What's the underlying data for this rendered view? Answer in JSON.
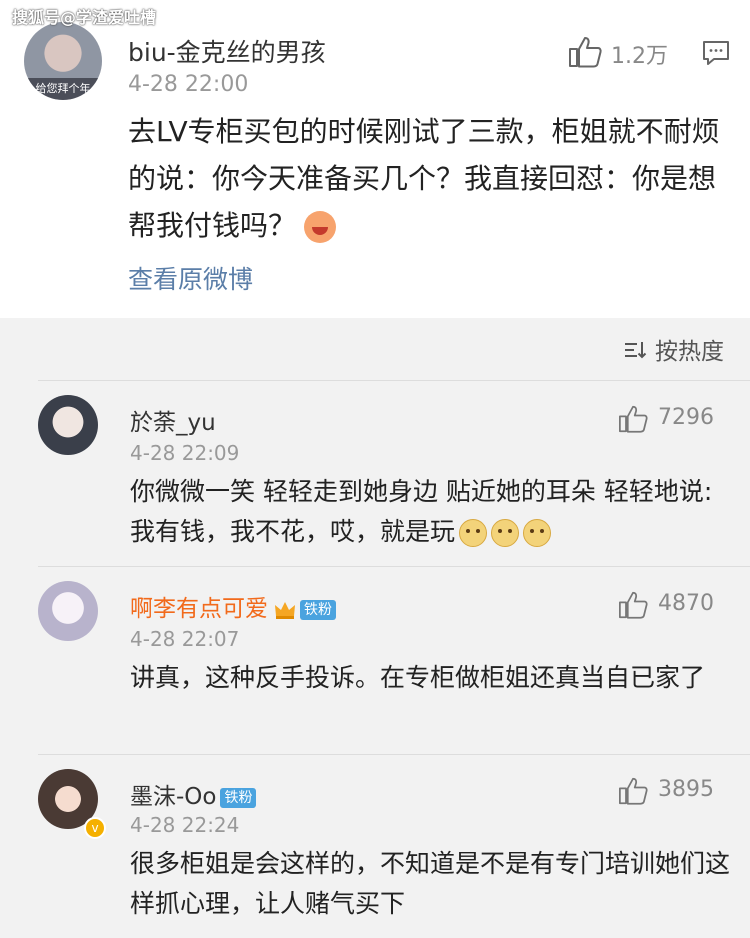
{
  "watermark": "搜狐号@学渣爱吐槽",
  "main_post": {
    "avatar_caption": "给您拜个年",
    "username": "biu-金克丝的男孩",
    "time": "4-28 22:00",
    "like_count": "1.2万",
    "text": "去LV专柜买包的时候刚试了三款，柜姐就不耐烦的说：你今天准备买几个？我直接回怼：你是想帮我付钱吗？",
    "view_original": "查看原微博"
  },
  "sort_label": "按热度",
  "comments": [
    {
      "username": "於荼_yu",
      "time": "4-28 22:09",
      "likes": "7296",
      "text": "你微微一笑 轻轻走到她身边 贴近她的耳朵 轻轻地说:我有钱，我不花，哎，就是玩",
      "name_color": "#333333"
    },
    {
      "username": "啊李有点可爱",
      "badge": "铁粉",
      "time": "4-28 22:07",
      "likes": "4870",
      "text": "讲真，这种反手投诉。在专柜做柜姐还真当自已家了",
      "name_color": "#f26a1b"
    },
    {
      "username": "墨沫-Oo",
      "badge": "铁粉",
      "time": "4-28 22:24",
      "likes": "3895",
      "text": "很多柜姐是会这样的，不知道是不是有专门培训她们这样抓心理，让人赌气买下",
      "name_color": "#333333"
    }
  ],
  "colors": {
    "link": "#5b7ea8",
    "orange_name": "#f26a1b",
    "badge": "#4aa3df"
  }
}
